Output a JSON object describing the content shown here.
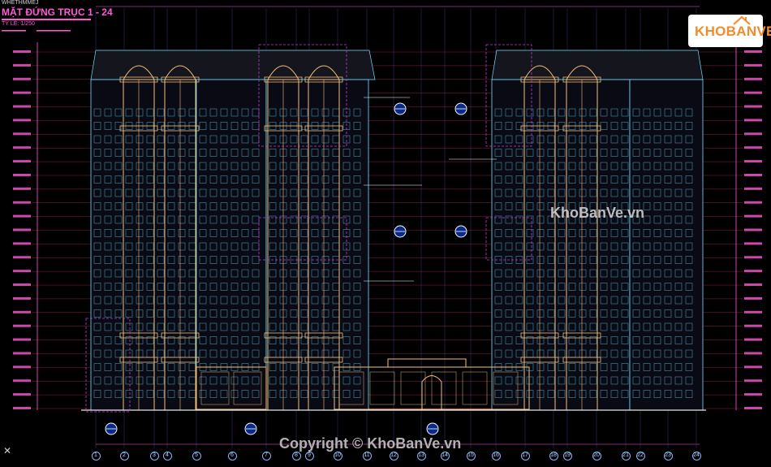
{
  "sheet_tag": "WHETHMMEJ",
  "drawing": {
    "title": "MẶT ĐỨNG TRỤC 1 - 24",
    "scale": "TỶ LỆ: 1/250"
  },
  "logo": {
    "text": "KHOBANVE"
  },
  "watermarks": {
    "center": "KhoBanVe.vn",
    "bottom": "Copyright © KhoBanVe.vn"
  },
  "close_glyph": "✕",
  "grid_axis_labels": [
    "1",
    "2",
    "3",
    "4",
    "5",
    "6",
    "7",
    "8",
    "9",
    "10",
    "11",
    "12",
    "13",
    "14",
    "15",
    "16",
    "17",
    "18",
    "19",
    "20",
    "21",
    "22",
    "23",
    "24"
  ],
  "colors": {
    "background": "#000000",
    "building_outline": "#6de0ff",
    "column_outline": "#f2c07a",
    "level_line": "#ff3b6b",
    "dim_text": "#ff5ad6",
    "grid_line": "#6a7cff",
    "annotation": "#ffffff"
  }
}
